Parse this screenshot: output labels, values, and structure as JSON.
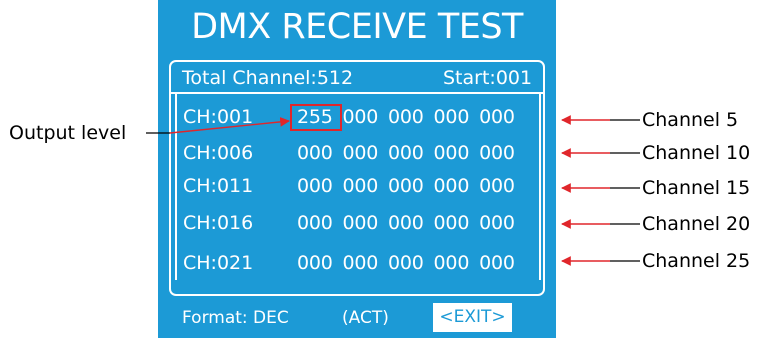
{
  "screen": {
    "title": "DMX RECEIVE TEST",
    "total_channel": "Total Channel:512",
    "start": "Start:001",
    "rows": [
      {
        "ch": "CH:001",
        "values": [
          "255",
          "000",
          "000",
          "000",
          "000"
        ]
      },
      {
        "ch": "CH:006",
        "values": [
          "000",
          "000",
          "000",
          "000",
          "000"
        ]
      },
      {
        "ch": "CH:011",
        "values": [
          "000",
          "000",
          "000",
          "000",
          "000"
        ]
      },
      {
        "ch": "CH:016",
        "values": [
          "000",
          "000",
          "000",
          "000",
          "000"
        ]
      },
      {
        "ch": "CH:021",
        "values": [
          "000",
          "000",
          "000",
          "000",
          "000"
        ]
      }
    ],
    "format": "Format: DEC",
    "act": "(ACT)",
    "exit_label": "<EXIT>"
  },
  "annotations": {
    "output_level": "Output level",
    "channel_labels": [
      "Channel 5",
      "Channel 10",
      "Channel 15",
      "Channel 20",
      "Channel 25"
    ]
  },
  "colors": {
    "screen_bg": "#1c9ad6",
    "text": "#ffffff",
    "annotation_red": "#e0262b"
  }
}
